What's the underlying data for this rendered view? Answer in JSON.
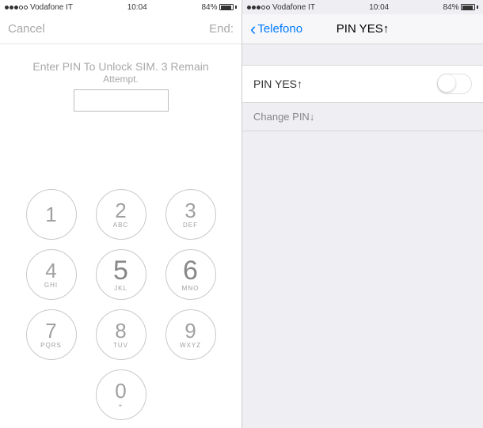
{
  "status": {
    "carrier": "Vodafone IT",
    "time": "10:04",
    "battery_pct": "84%"
  },
  "left": {
    "nav": {
      "cancel": "Cancel",
      "end": "End:"
    },
    "prompt_line1": "Enter PIN To Unlock SIM. 3 Remain",
    "prompt_line2": "Attempt.",
    "keys": [
      {
        "d": "1",
        "l": ""
      },
      {
        "d": "2",
        "l": "ABC"
      },
      {
        "d": "3",
        "l": "DEF"
      },
      {
        "d": "4",
        "l": "GHI"
      },
      {
        "d": "5",
        "l": "JKL"
      },
      {
        "d": "6",
        "l": "MNO"
      },
      {
        "d": "7",
        "l": "PQRS"
      },
      {
        "d": "8",
        "l": "TUV"
      },
      {
        "d": "9",
        "l": "WXYZ"
      },
      {
        "d": "0",
        "l": "+"
      }
    ]
  },
  "right": {
    "nav": {
      "back": "Telefono",
      "title": "PIN YES↑"
    },
    "row_label": "PIN YES↑",
    "change_pin": "Change PIN↓"
  }
}
